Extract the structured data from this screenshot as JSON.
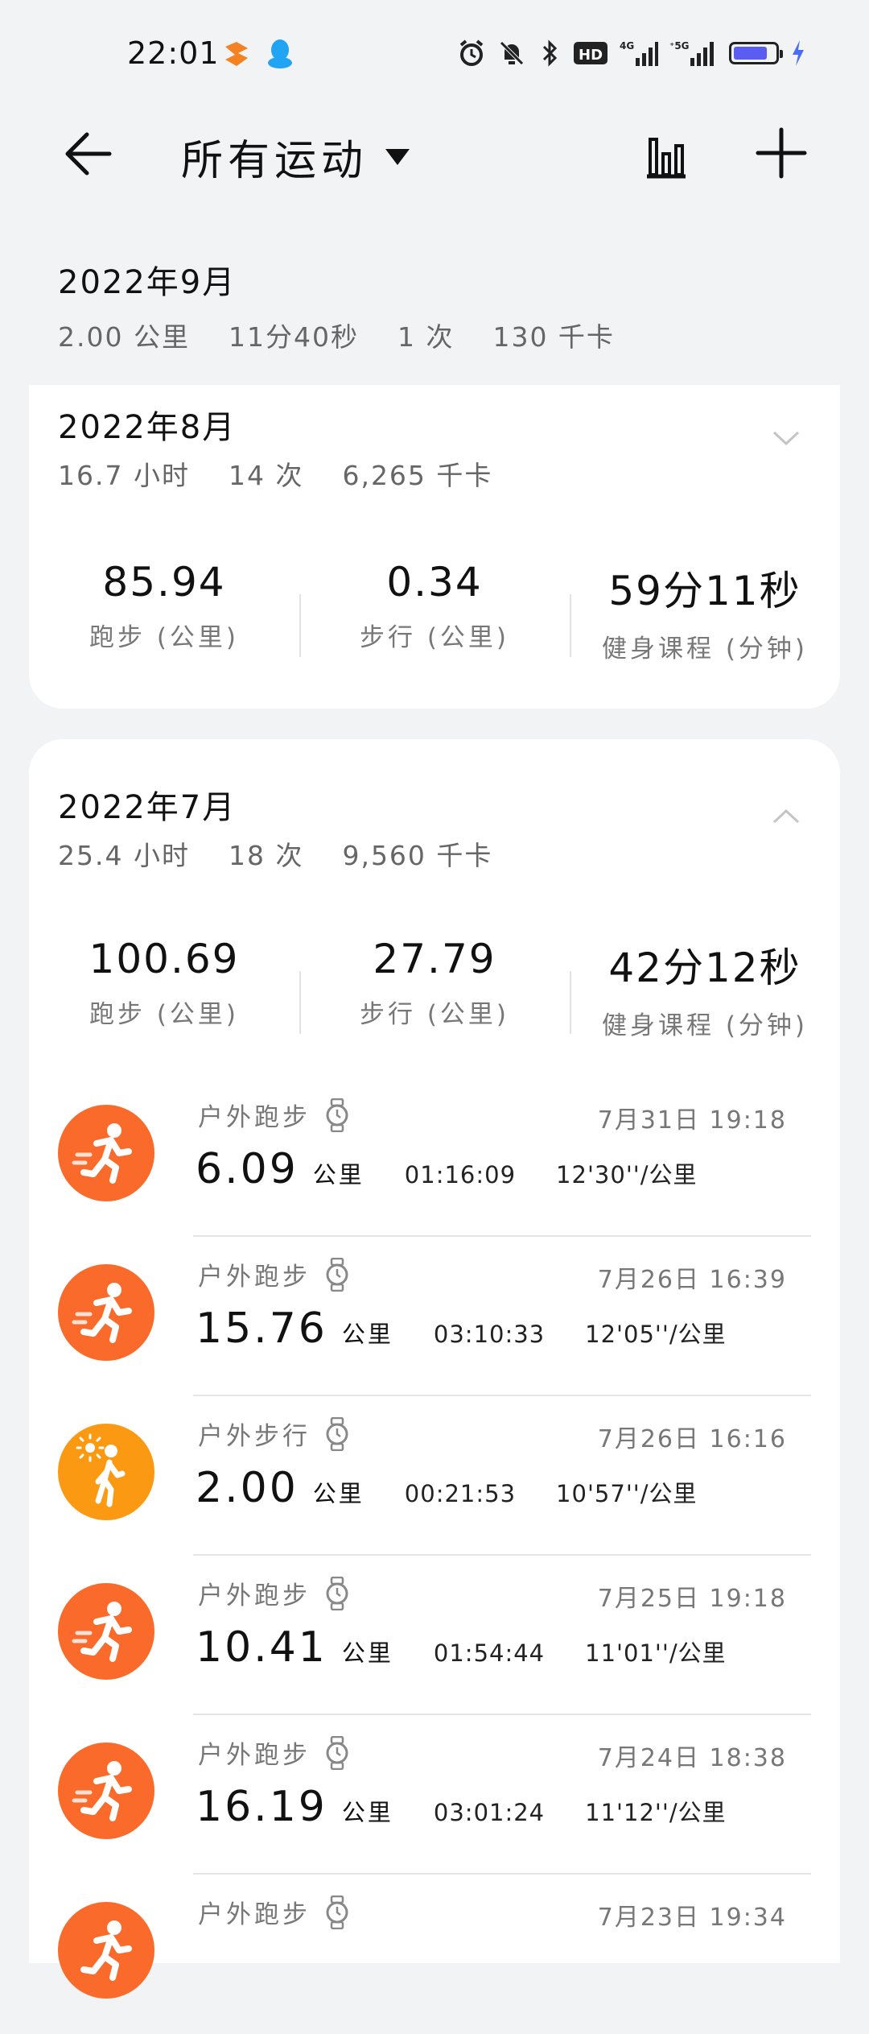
{
  "status_bar": {
    "time": "22:01",
    "battery_level": 0.82,
    "colors": {
      "battery": "#5a5df0",
      "charging": "#4a6cf7",
      "app1": "#f58220",
      "app2": "#20a4f3"
    }
  },
  "header": {
    "back_icon": "arrow-left-icon",
    "filter_label": "所有运动",
    "stats_icon": "bar-chart-icon",
    "add_icon": "plus-icon"
  },
  "months": {
    "sep": {
      "title": "2022年9月",
      "distance": "2.00 公里",
      "duration": "11分40秒",
      "count": "1 次",
      "calories": "130 千卡"
    },
    "aug": {
      "title": "2022年8月",
      "duration": "16.7 小时",
      "count": "14 次",
      "calories": "6,265 千卡",
      "stats": [
        {
          "value": "85.94",
          "label": "跑步 (公里)"
        },
        {
          "value": "0.34",
          "label": "步行 (公里)"
        },
        {
          "value": "59分11秒",
          "label": "健身课程 (分钟)"
        }
      ]
    },
    "jul": {
      "title": "2022年7月",
      "duration": "25.4 小时",
      "count": "18 次",
      "calories": "9,560 千卡",
      "stats": [
        {
          "value": "100.69",
          "label": "跑步 (公里)"
        },
        {
          "value": "27.79",
          "label": "步行 (公里)"
        },
        {
          "value": "42分12秒",
          "label": "健身课程 (分钟)"
        }
      ]
    }
  },
  "activities": [
    {
      "type": "户外跑步",
      "datetime": "7月31日 19:18",
      "distance": "6.09",
      "unit": "公里",
      "duration": "01:16:09",
      "pace": "12'30''/公里",
      "icon": "running-icon",
      "color": "#fa6a2a"
    },
    {
      "type": "户外跑步",
      "datetime": "7月26日 16:39",
      "distance": "15.76",
      "unit": "公里",
      "duration": "03:10:33",
      "pace": "12'05''/公里",
      "icon": "running-icon",
      "color": "#fa6a2a"
    },
    {
      "type": "户外步行",
      "datetime": "7月26日 16:16",
      "distance": "2.00",
      "unit": "公里",
      "duration": "00:21:53",
      "pace": "10'57''/公里",
      "icon": "walking-icon",
      "color": "#fb9a12"
    },
    {
      "type": "户外跑步",
      "datetime": "7月25日 19:18",
      "distance": "10.41",
      "unit": "公里",
      "duration": "01:54:44",
      "pace": "11'01''/公里",
      "icon": "running-icon",
      "color": "#fa6a2a"
    },
    {
      "type": "户外跑步",
      "datetime": "7月24日 18:38",
      "distance": "16.19",
      "unit": "公里",
      "duration": "03:01:24",
      "pace": "11'12''/公里",
      "icon": "running-icon",
      "color": "#fa6a2a"
    },
    {
      "type": "户外跑步",
      "datetime": "7月23日 19:34",
      "distance": "",
      "unit": "",
      "duration": "",
      "pace": "",
      "icon": "running-icon",
      "color": "#fa6a2a"
    }
  ]
}
